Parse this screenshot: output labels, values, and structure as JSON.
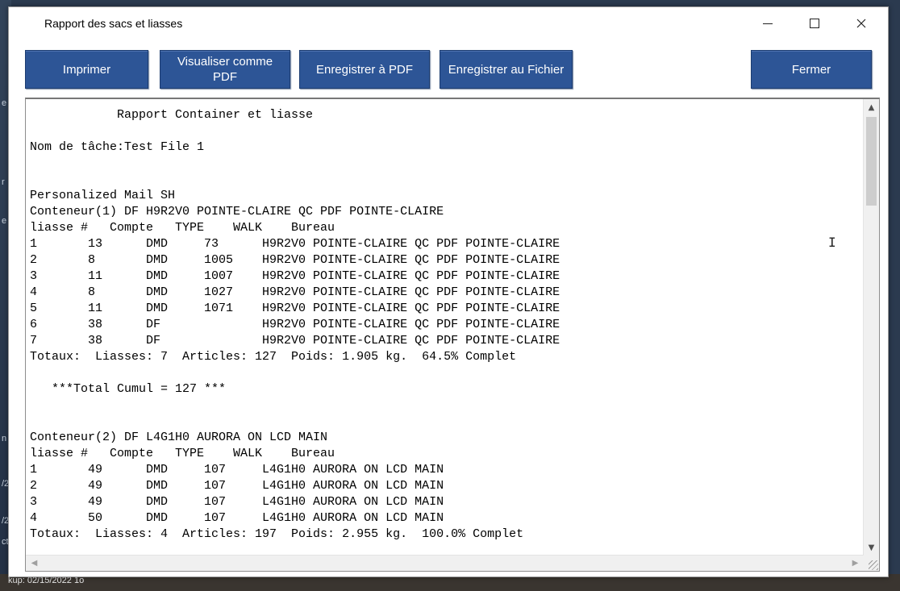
{
  "window": {
    "title": "Rapport des sacs et liasses"
  },
  "icons": {
    "minimize": "minimize-icon",
    "maximize": "maximize-icon",
    "close": "close-icon"
  },
  "toolbar": {
    "print_label": "Imprimer",
    "view_pdf_label": "Visualiser comme PDF",
    "save_pdf_label": "Enregistrer à PDF",
    "save_file_label": "Enregistrer au Fichier",
    "close_label": "Fermer"
  },
  "report": {
    "lines": [
      "            Rapport Container et liasse",
      "",
      "Nom de tâche:Test File 1",
      "",
      "",
      "Personalized Mail SH",
      "Conteneur(1) DF H9R2V0 POINTE-CLAIRE QC PDF POINTE-CLAIRE",
      "liasse #   Compte   TYPE    WALK    Bureau",
      "1       13      DMD     73      H9R2V0 POINTE-CLAIRE QC PDF POINTE-CLAIRE",
      "2       8       DMD     1005    H9R2V0 POINTE-CLAIRE QC PDF POINTE-CLAIRE",
      "3       11      DMD     1007    H9R2V0 POINTE-CLAIRE QC PDF POINTE-CLAIRE",
      "4       8       DMD     1027    H9R2V0 POINTE-CLAIRE QC PDF POINTE-CLAIRE",
      "5       11      DMD     1071    H9R2V0 POINTE-CLAIRE QC PDF POINTE-CLAIRE",
      "6       38      DF              H9R2V0 POINTE-CLAIRE QC PDF POINTE-CLAIRE",
      "7       38      DF              H9R2V0 POINTE-CLAIRE QC PDF POINTE-CLAIRE",
      "Totaux:  Liasses: 7  Articles: 127  Poids: 1.905 kg.  64.5% Complet",
      "",
      "   ***Total Cumul = 127 ***",
      "",
      "",
      "Conteneur(2) DF L4G1H0 AURORA ON LCD MAIN",
      "liasse #   Compte   TYPE    WALK    Bureau",
      "1       49      DMD     107     L4G1H0 AURORA ON LCD MAIN",
      "2       49      DMD     107     L4G1H0 AURORA ON LCD MAIN",
      "3       49      DMD     107     L4G1H0 AURORA ON LCD MAIN",
      "4       50      DMD     107     L4G1H0 AURORA ON LCD MAIN",
      "Totaux:  Liasses: 4  Articles: 197  Poids: 2.955 kg.  100.0% Complet"
    ]
  },
  "desktop": {
    "fragments": [
      "e",
      "r",
      "e",
      "n",
      "/2",
      "/2",
      "ct"
    ],
    "bottom_text": "kup: 02/15/2022 1o"
  }
}
